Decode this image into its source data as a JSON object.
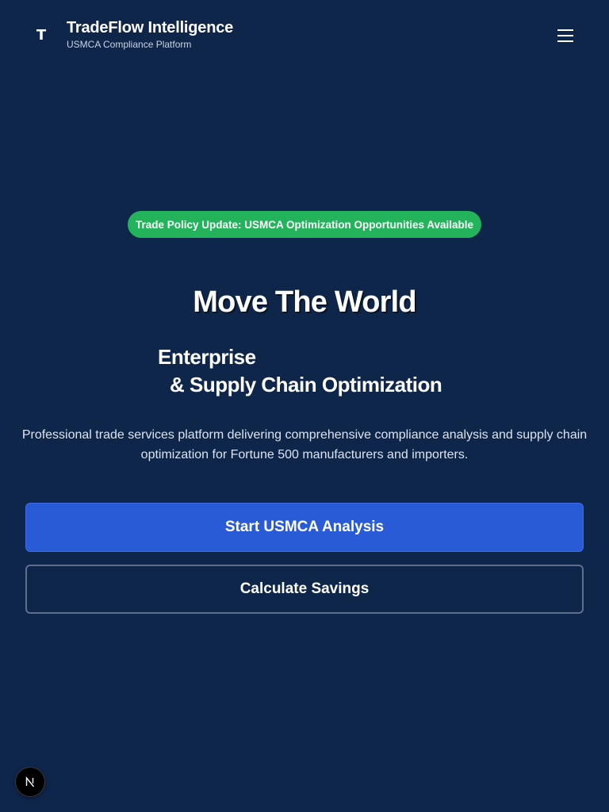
{
  "header": {
    "logo_letter": "T",
    "brand_name": "TradeFlow Intelligence",
    "brand_subtitle": "USMCA Compliance Platform",
    "menu_icon": "hamburger-menu-icon"
  },
  "announcement": {
    "text": "Trade Policy Update: USMCA Optimization Opportunities Available"
  },
  "hero": {
    "title": "Move The World",
    "subtitle_line_1": "Enterprise",
    "subtitle_line_2": "& Supply Chain Optimization",
    "description": "Professional trade services platform delivering comprehensive compliance analysis and supply chain optimization for Fortune 500 manufacturers and importers."
  },
  "actions": {
    "primary_label": "Start USMCA Analysis",
    "secondary_label": "Calculate Savings"
  },
  "dev_indicator": {
    "letter": "N",
    "icon": "nextjs-logo-icon"
  },
  "colors": {
    "background": "#0f264b",
    "accent_green": "#22b35b",
    "primary_blue": "#2a5bd7",
    "outline": "#5d6f8c"
  }
}
